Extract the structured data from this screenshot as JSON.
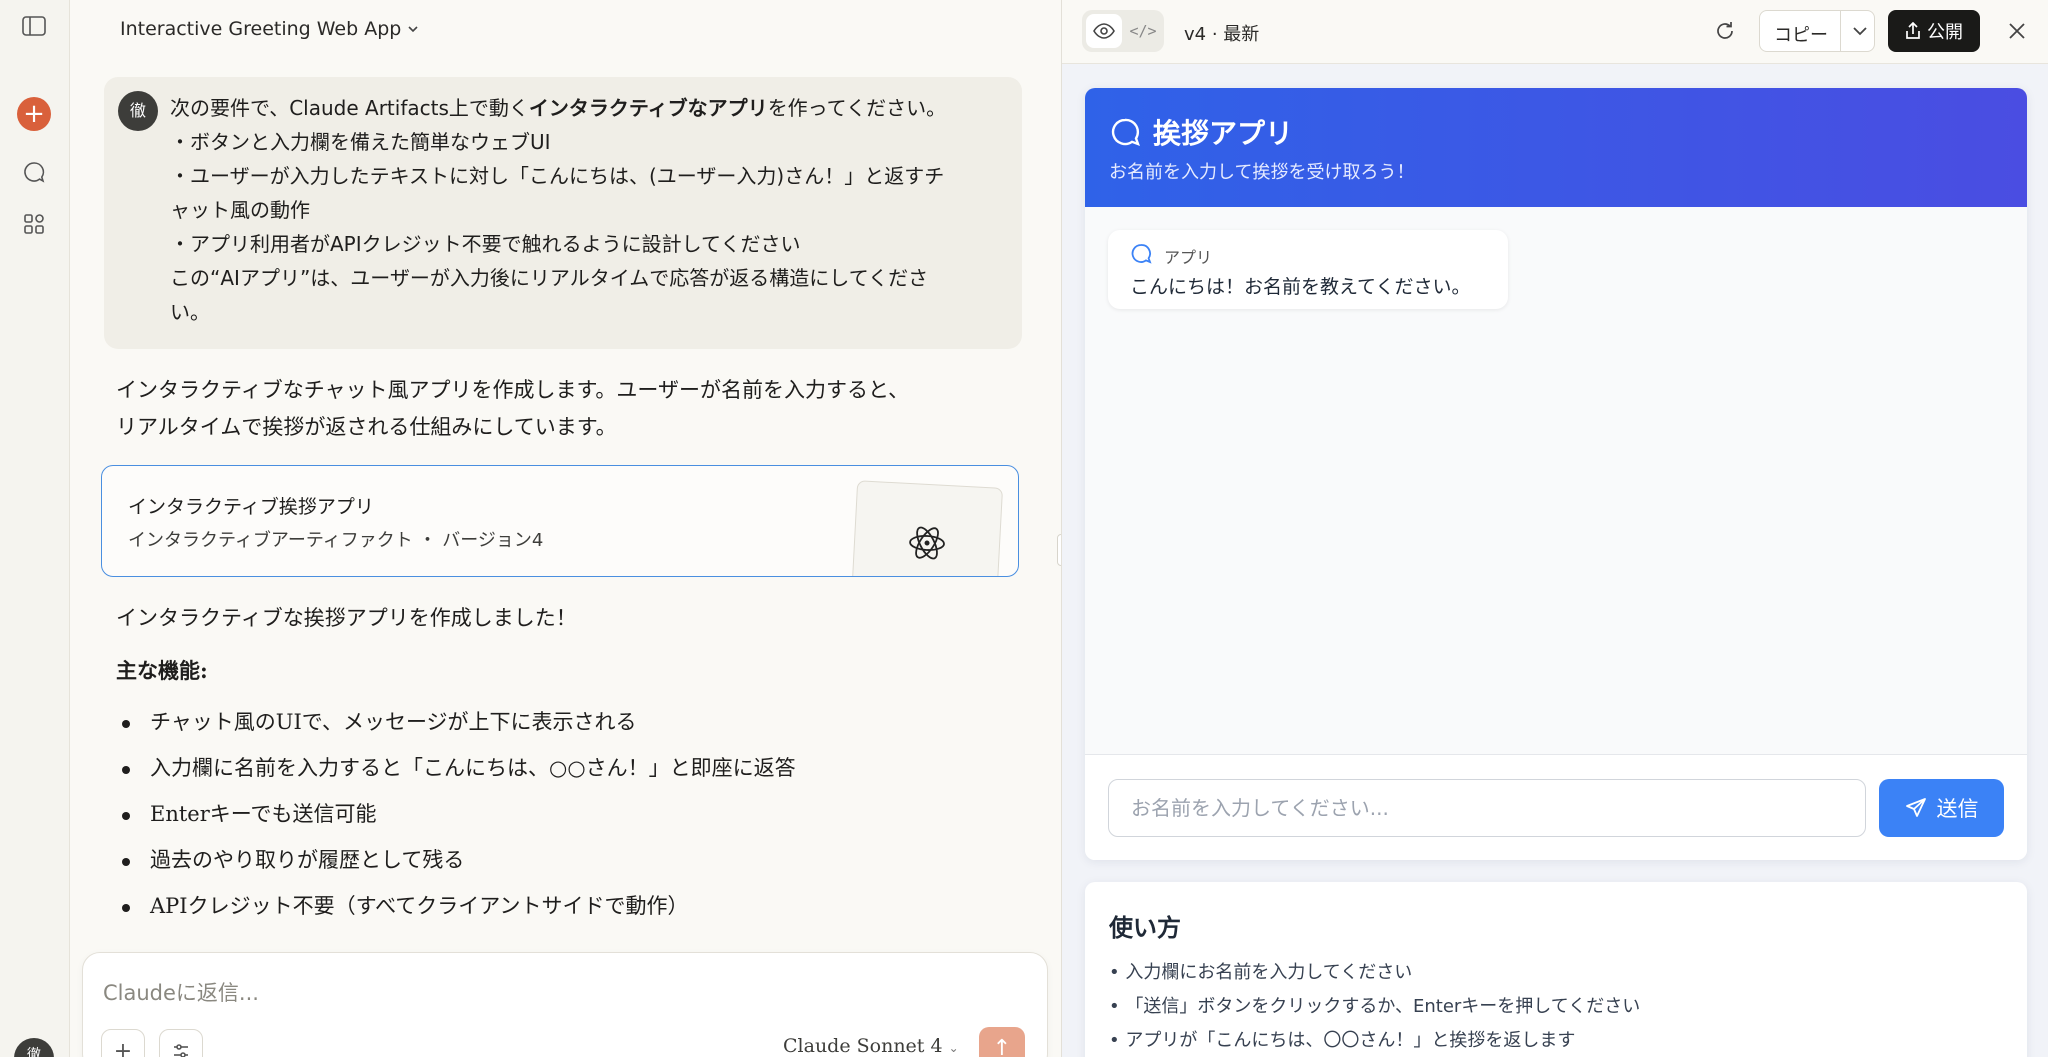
{
  "rail": {
    "icons": [
      "sidebar-toggle-icon",
      "new-chat-icon",
      "chats-icon",
      "projects-icon"
    ],
    "avatar": "徹"
  },
  "chat": {
    "title": "Interactive Greeting Web App",
    "user_avatar": "徹",
    "user_message": {
      "line1_a": "次の要件で、Claude Artifacts上で動く",
      "line1_b": "インタラクティブなアプリ",
      "line1_c": "を作ってください。",
      "line2": "・ボタンと入力欄を備えた簡単なウェブUI",
      "line3": "・ユーザーが入力したテキストに対し「こんにちは、(ユーザー入力)さん！」と返すチ",
      "line4": "ャット風の動作",
      "line5": "・アプリ利用者がAPIクレジット不要で触れるように設計してください",
      "line6": "この“AIアプリ”は、ユーザーが入力後にリアルタイムで応答が返る構造にしてくださ",
      "line7": "い。"
    },
    "response_intro_1": "インタラクティブなチャット風アプリを作成します。ユーザーが名前を入力すると、",
    "response_intro_2": "リアルタイムで挨拶が返される仕組みにしています。",
    "artifact_card": {
      "title": "インタラクティブ挨拶アプリ",
      "subtitle": "インタラクティブアーティファクト ・ バージョン4"
    },
    "response_done": "インタラクティブな挨拶アプリを作成しました！",
    "features_heading": "主な機能:",
    "features": [
      "チャット風のUIで、メッセージが上下に表示される",
      "入力欄に名前を入力すると「こんにちは、○○さん！」と即座に返答",
      "Enterキーでも送信可能",
      "過去のやり取りが履歴として残る",
      "APIクレジット不要（すべてクライアントサイドで動作）"
    ],
    "composer": {
      "placeholder": "Claudeに返信...",
      "add_label": "+",
      "model": "Claude Sonnet 4"
    }
  },
  "panel": {
    "version": "v4 · 最新",
    "copy_label": "コピー",
    "publish_label": "公開",
    "app": {
      "title": "挨拶アプリ",
      "subtitle": "お名前を入力して挨拶を受け取ろう！",
      "bubble_sender": "アプリ",
      "bubble_text": "こんにちは！お名前を教えてください。",
      "input_placeholder": "お名前を入力してください...",
      "send_label": "送信",
      "accent": "#3b82f6"
    },
    "howto": {
      "heading": "使い方",
      "items": [
        "• 入力欄にお名前を入力してください",
        "• 「送信」ボタンをクリックするか、Enterキーを押してください",
        "• アプリが「こんにちは、〇〇さん！」と挨拶を返します"
      ]
    }
  }
}
